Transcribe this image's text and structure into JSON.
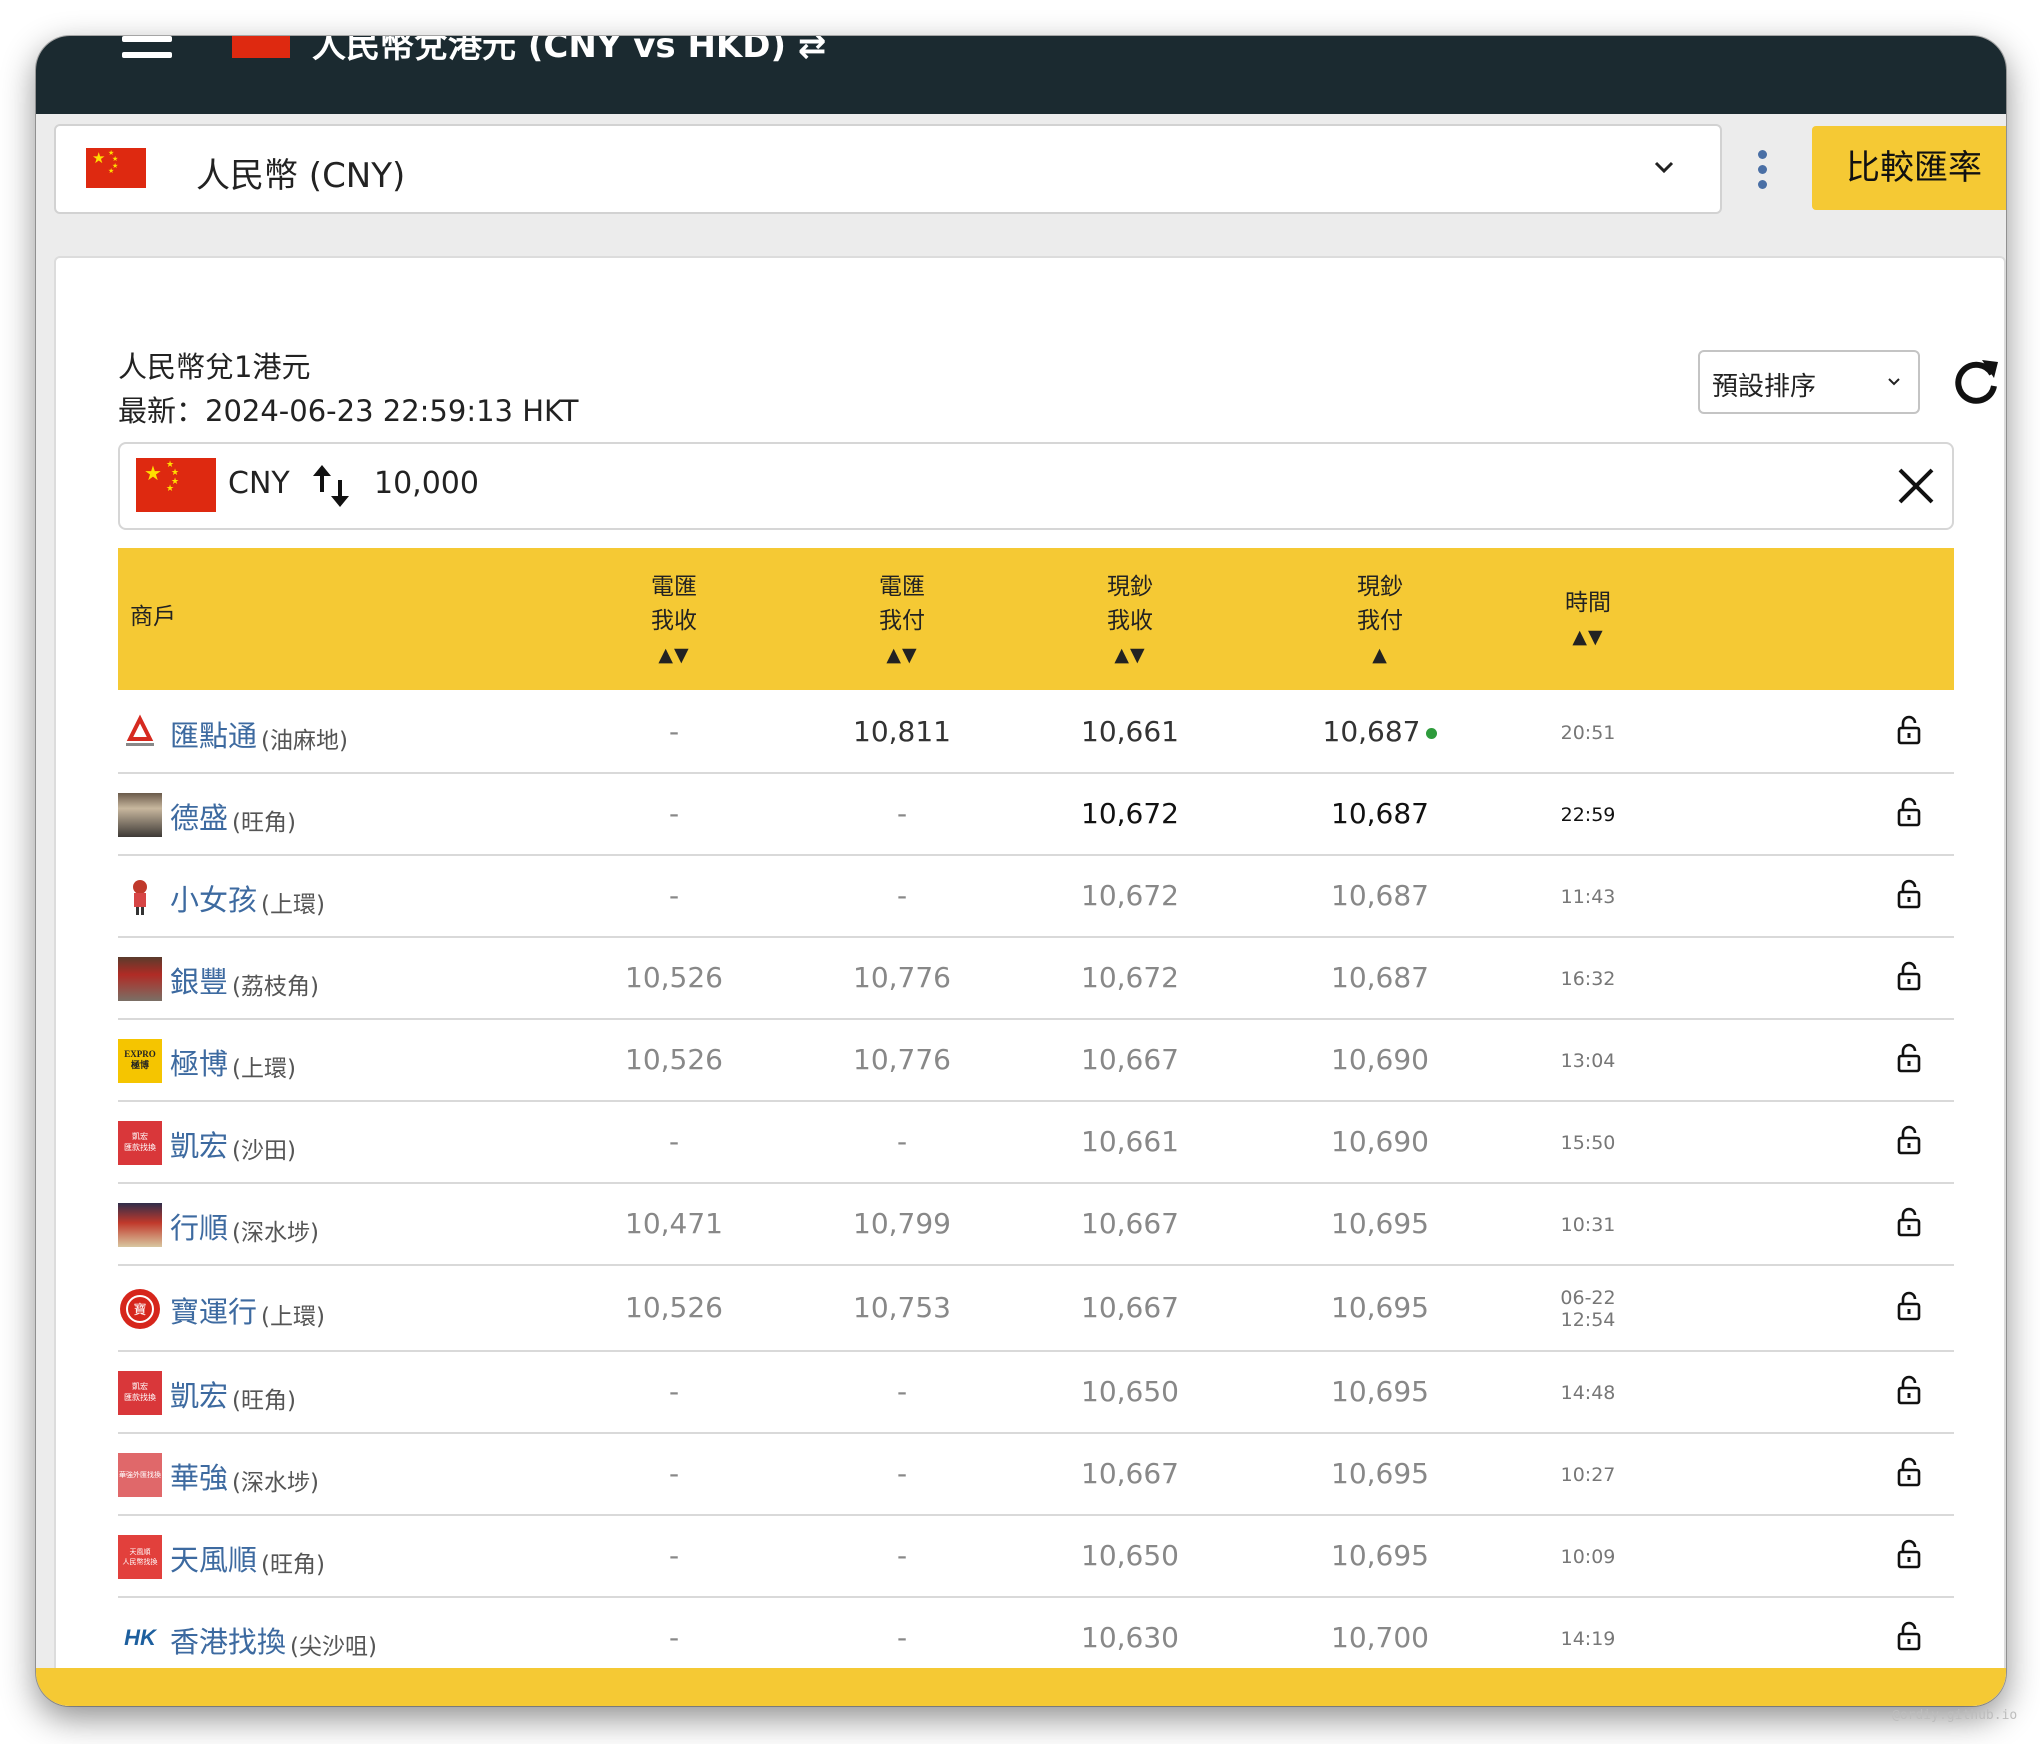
{
  "header": {
    "title": "人民幣兌港元 (CNY vs HKD) ⇄",
    "menu_icon": "hamburger-icon"
  },
  "currency_select": {
    "value": "人民幣 (CNY)"
  },
  "compare_button": "比較匯率",
  "card": {
    "subtitle": "人民幣兌1港元",
    "updated": "最新：2024-06-23 22:59:13 HKT"
  },
  "sort": {
    "selected": "預設排序"
  },
  "converter": {
    "currency": "CNY",
    "amount": "10,000"
  },
  "table": {
    "headers": {
      "merchant": "商戶",
      "tt_buy_1": "電匯",
      "tt_buy_2": "我收",
      "tt_buy_arrows": "▲▼",
      "tt_sell_1": "電匯",
      "tt_sell_2": "我付",
      "tt_sell_arrows": "▲▼",
      "cash_buy_1": "現鈔",
      "cash_buy_2": "我收",
      "cash_buy_arrows": "▲▼",
      "cash_sell_1": "現鈔",
      "cash_sell_2": "我付",
      "cash_sell_arrows": "▲",
      "time_1": "時間",
      "time_arrows": "▲▼"
    },
    "rows": [
      {
        "name": "匯點通",
        "district": "(油麻地)",
        "tt_buy": "-",
        "tt_sell": "10,811",
        "cash_buy": "10,661",
        "cash_sell": "10,687",
        "time": "20:51",
        "time2": "",
        "best": true
      },
      {
        "name": "德盛",
        "district": "(旺角)",
        "tt_buy": "-",
        "tt_sell": "-",
        "cash_buy": "10,672",
        "cash_sell": "10,687",
        "time": "22:59",
        "time2": "",
        "best": false
      },
      {
        "name": "小女孩",
        "district": "(上環)",
        "tt_buy": "-",
        "tt_sell": "-",
        "cash_buy": "10,672",
        "cash_sell": "10,687",
        "time": "11:43",
        "time2": "",
        "best": false
      },
      {
        "name": "銀豐",
        "district": "(荔枝角)",
        "tt_buy": "10,526",
        "tt_sell": "10,776",
        "cash_buy": "10,672",
        "cash_sell": "10,687",
        "time": "16:32",
        "time2": "",
        "best": false
      },
      {
        "name": "極博",
        "district": "(上環)",
        "tt_buy": "10,526",
        "tt_sell": "10,776",
        "cash_buy": "10,667",
        "cash_sell": "10,690",
        "time": "13:04",
        "time2": "",
        "best": false
      },
      {
        "name": "凱宏",
        "district": "(沙田)",
        "tt_buy": "-",
        "tt_sell": "-",
        "cash_buy": "10,661",
        "cash_sell": "10,690",
        "time": "15:50",
        "time2": "",
        "best": false
      },
      {
        "name": "行順",
        "district": "(深水埗)",
        "tt_buy": "10,471",
        "tt_sell": "10,799",
        "cash_buy": "10,667",
        "cash_sell": "10,695",
        "time": "10:31",
        "time2": "",
        "best": false
      },
      {
        "name": "寶運行",
        "district": "(上環)",
        "tt_buy": "10,526",
        "tt_sell": "10,753",
        "cash_buy": "10,667",
        "cash_sell": "10,695",
        "time": "06-22",
        "time2": "12:54",
        "best": false
      },
      {
        "name": "凱宏",
        "district": "(旺角)",
        "tt_buy": "-",
        "tt_sell": "-",
        "cash_buy": "10,650",
        "cash_sell": "10,695",
        "time": "14:48",
        "time2": "",
        "best": false
      },
      {
        "name": "華強",
        "district": "(深水埗)",
        "tt_buy": "-",
        "tt_sell": "-",
        "cash_buy": "10,667",
        "cash_sell": "10,695",
        "time": "10:27",
        "time2": "",
        "best": false
      },
      {
        "name": "天風順",
        "district": "(旺角)",
        "tt_buy": "-",
        "tt_sell": "-",
        "cash_buy": "10,650",
        "cash_sell": "10,695",
        "time": "10:09",
        "time2": "",
        "best": false
      },
      {
        "name": "香港找換",
        "district": "(尖沙咀)",
        "tt_buy": "-",
        "tt_sell": "-",
        "cash_buy": "10,630",
        "cash_sell": "10,700",
        "time": "14:19",
        "time2": "",
        "best": false
      }
    ],
    "logos": {
      "0": {
        "text": "",
        "1": ""
      },
      "4": {
        "text": "EXPRO",
        "text2": "極博"
      },
      "5": {
        "text": "凱宏",
        "text2": "匯款找換"
      },
      "7": {
        "text": "寶"
      },
      "8": {
        "text": "凱宏",
        "text2": "匯款找換"
      },
      "9": {
        "text": "華強外匯找換"
      },
      "10": {
        "text": "天風順",
        "text2": "人民幣找換"
      },
      "11": {
        "text": "HK"
      }
    }
  },
  "watermark": "@ordiy.github.io",
  "colors": {
    "accent": "#f5c934",
    "topbar": "#1b2a30",
    "link": "#3d6aa0",
    "best_dot": "#2e9b3c",
    "flag_red": "#de2910",
    "flag_star": "#ffde00"
  }
}
